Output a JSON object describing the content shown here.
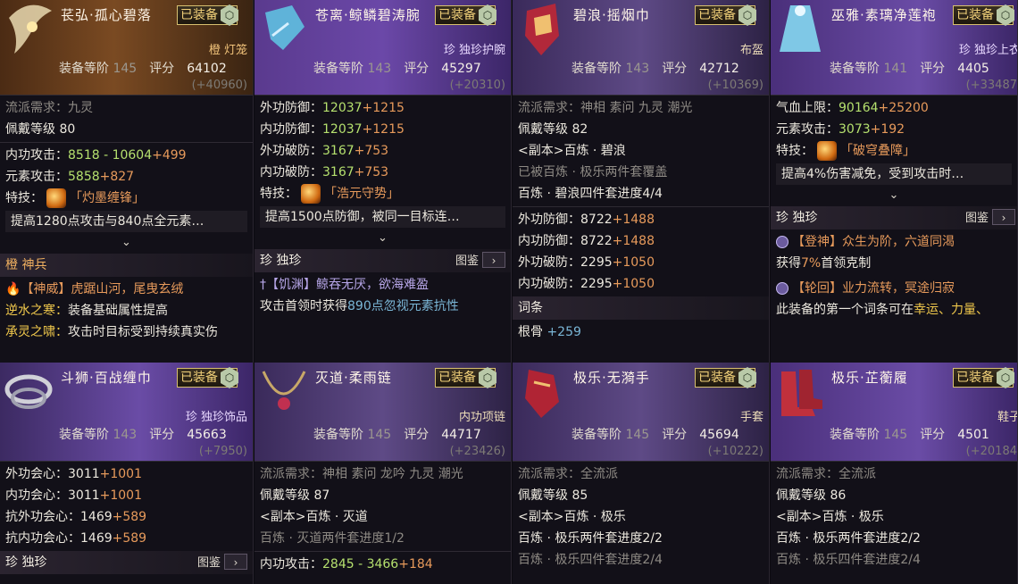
{
  "common": {
    "equipped": "已装备",
    "gear_level_label": "装备等阶",
    "score_label": "评分",
    "skill_label": "特技：",
    "chevron": "⌄",
    "tujian": "图鉴",
    "tujian_arrow": "›"
  },
  "cards": [
    {
      "title": "苌弘·孤心碧落",
      "slot": "橙 灯笼",
      "gear_level": "145",
      "score": "64102",
      "diff": "(+40960)",
      "lines": [
        {
          "a": "流派需求：九灵",
          "c": "gray"
        },
        {
          "a": "佩戴等级 80",
          "c": "wht"
        }
      ],
      "stats": [
        {
          "label": "内功攻击：",
          "v": "8518 - 10604",
          "b": "+499"
        },
        {
          "label": "元素攻击：",
          "v": "5858",
          "b": "+827"
        }
      ],
      "skill": "「灼墨缠锋」",
      "desc": "提高1280点攻击与840点全元素…",
      "section": "橙 神兵",
      "extra": [
        {
          "a": "【神威】",
          "b": "虎踞山河，尾曳玄绒"
        },
        {
          "a": "逆水之寒：",
          "b": "装备基础属性提高"
        },
        {
          "a": "承灵之啸：",
          "b": "攻击时目标受到持续真实伤"
        }
      ]
    },
    {
      "title": "苍离·鲸鳞碧涛腕",
      "slot": "珍 独珍护腕",
      "gear_level": "143",
      "score": "45297",
      "diff": "(+20310)",
      "stats": [
        {
          "label": "外功防御：",
          "v": "12037",
          "b": "+1215"
        },
        {
          "label": "内功防御：",
          "v": "12037",
          "b": "+1215"
        },
        {
          "label": "外功破防：",
          "v": "3167",
          "b": "+753"
        },
        {
          "label": "内功破防：",
          "v": "3167",
          "b": "+753"
        }
      ],
      "skill": "「浩元守势」",
      "desc": "提高1500点防御，被同一目标连…",
      "section": "珍 独珍",
      "extra": [
        {
          "a": "【饥渊】",
          "b": "鲸吞无厌，欲海难盈"
        },
        {
          "a": "攻击首领时获得",
          "v": "890点",
          "b": "忽视元素抗性"
        }
      ]
    },
    {
      "title": "碧浪·摇烟巾",
      "slot": "布盔",
      "gear_level": "143",
      "score": "42712",
      "diff": "(+10369)",
      "lines": [
        {
          "a": "流派需求：神相 素问 九灵 潮光",
          "c": "gray"
        },
        {
          "a": "佩戴等级 82",
          "c": "wht"
        },
        {
          "a": "<副本>百炼 · 碧浪",
          "c": "wht"
        },
        {
          "a": "已被百炼 · 极乐两件套覆盖",
          "c": "gray"
        },
        {
          "a": "百炼 · 碧浪四件套进度4/4",
          "c": "wht"
        }
      ],
      "stats": [
        {
          "label": "外功防御：",
          "v": "8722",
          "b": "+1488"
        },
        {
          "label": "内功防御：",
          "v": "8722",
          "b": "+1488"
        },
        {
          "label": "外功破防：",
          "v": "2295",
          "b": "+1050"
        },
        {
          "label": "内功破防：",
          "v": "2295",
          "b": "+1050"
        }
      ],
      "section": "词条",
      "extra": [
        {
          "a": "根骨 ",
          "b": "+259"
        }
      ]
    },
    {
      "title": "巫雅·素璃净莲袍",
      "slot": "珍 独珍上衣",
      "gear_level": "141",
      "score": "4405",
      "diff": "(+33487",
      "stats": [
        {
          "label": "气血上限：",
          "v": "90164",
          "b": "+25200"
        },
        {
          "label": "元素攻击：",
          "v": "3073",
          "b": "+192"
        }
      ],
      "skill": "「破穹叠障」",
      "desc": "提高4%伤害减免，受到攻击时…",
      "section": "珍 独珍",
      "extra": [
        {
          "a": "【登神】",
          "b": "众生为阶，六道同渴"
        },
        {
          "a": "获得",
          "v": "7%",
          "b": "首领克制"
        },
        {
          "a": "【轮回】",
          "b": "业力流转，冥途归寂"
        },
        {
          "a": "此装备的第一个词条可在",
          "v": "幸运、力量、",
          "b": ""
        }
      ]
    },
    {
      "title": "斗狮·百战缠巾",
      "slot": "珍 独珍饰品",
      "gear_level": "143",
      "score": "45663",
      "diff": "(+7950)",
      "stats": [
        {
          "label": "外功会心：",
          "v": "3011",
          "b": "+1001"
        },
        {
          "label": "内功会心：",
          "v": "3011",
          "b": "+1001"
        },
        {
          "label": "抗外功会心：",
          "v": "1469",
          "b": "+589"
        },
        {
          "label": "抗内功会心：",
          "v": "1469",
          "b": "+589"
        }
      ],
      "section": "珍 独珍"
    },
    {
      "title": "灭道·柔雨链",
      "slot": "内功项链",
      "gear_level": "145",
      "score": "44717",
      "diff": "(+23426)",
      "lines": [
        {
          "a": "流派需求：神相 素问 龙吟 九灵 潮光",
          "c": "gray"
        },
        {
          "a": "佩戴等级 87",
          "c": "wht"
        },
        {
          "a": "<副本>百炼 · 灭道",
          "c": "wht"
        },
        {
          "a": "百炼 · 灭道两件套进度1/2",
          "c": "gray"
        }
      ],
      "stats": [
        {
          "label": "内功攻击：",
          "v": "2845 - 3466",
          "b": "+184"
        }
      ]
    },
    {
      "title": "极乐·无漪手",
      "slot": "手套",
      "gear_level": "145",
      "score": "45694",
      "diff": "(+10222)",
      "lines": [
        {
          "a": "流派需求：全流派",
          "c": "gray"
        },
        {
          "a": "佩戴等级 85",
          "c": "wht"
        },
        {
          "a": "<副本>百炼 · 极乐",
          "c": "wht"
        },
        {
          "a": "百炼 · 极乐两件套进度2/2",
          "c": "wht"
        },
        {
          "a": "百炼 · 极乐四件套进度2/4",
          "c": "gray"
        }
      ]
    },
    {
      "title": "极乐·芷蘅履",
      "slot": "鞋子",
      "gear_level": "145",
      "score": "4501",
      "diff": "(+20184",
      "lines": [
        {
          "a": "流派需求：全流派",
          "c": "gray"
        },
        {
          "a": "佩戴等级 86",
          "c": "wht"
        },
        {
          "a": "<副本>百炼 · 极乐",
          "c": "wht"
        },
        {
          "a": "百炼 · 极乐两件套进度2/2",
          "c": "wht"
        },
        {
          "a": "百炼 · 极乐四件套进度2/4",
          "c": "gray"
        }
      ]
    }
  ],
  "colors": {
    "head_orange": "#7a4a22",
    "head_purple": "#4a2f7a",
    "badge_gold": "#f3d27a"
  }
}
